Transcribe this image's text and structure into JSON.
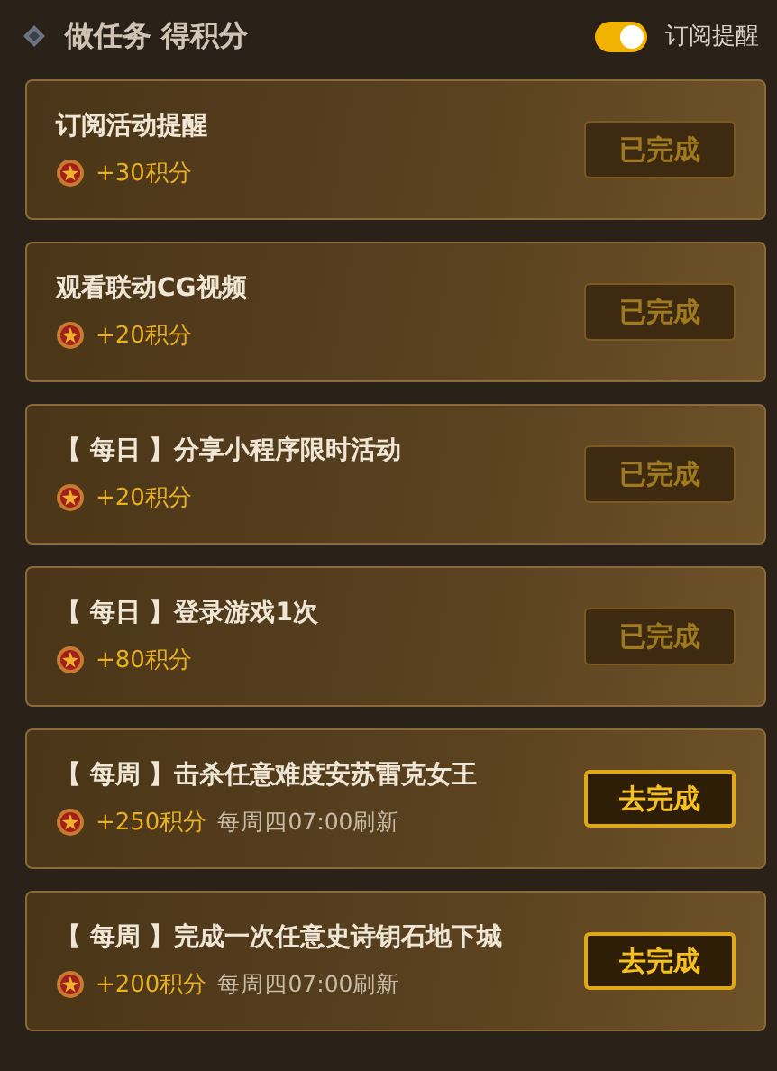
{
  "header": {
    "title": "做任务 得积分",
    "subscribe_toggle": {
      "label": "订阅提醒",
      "on": true
    }
  },
  "tasks": [
    {
      "title": "订阅活动提醒",
      "points": "+30积分",
      "button": "已完成",
      "done": true
    },
    {
      "title": "观看联动CG视频",
      "points": "+20积分",
      "button": "已完成",
      "done": true
    },
    {
      "title": "【 每日 】分享小程序限时活动",
      "points": "+20积分",
      "button": "已完成",
      "done": true
    },
    {
      "title": "【 每日 】登录游戏1次",
      "points": "+80积分",
      "button": "已完成",
      "done": true
    },
    {
      "title": "【 每周 】击杀任意难度安苏雷克女王",
      "points": "+250积分",
      "refresh": "每周四07:00刷新",
      "button": "去完成",
      "done": false
    },
    {
      "title": "【 每周 】完成一次任意史诗钥石地下城",
      "points": "+200积分",
      "refresh": "每周四07:00刷新",
      "button": "去完成",
      "done": false
    }
  ]
}
